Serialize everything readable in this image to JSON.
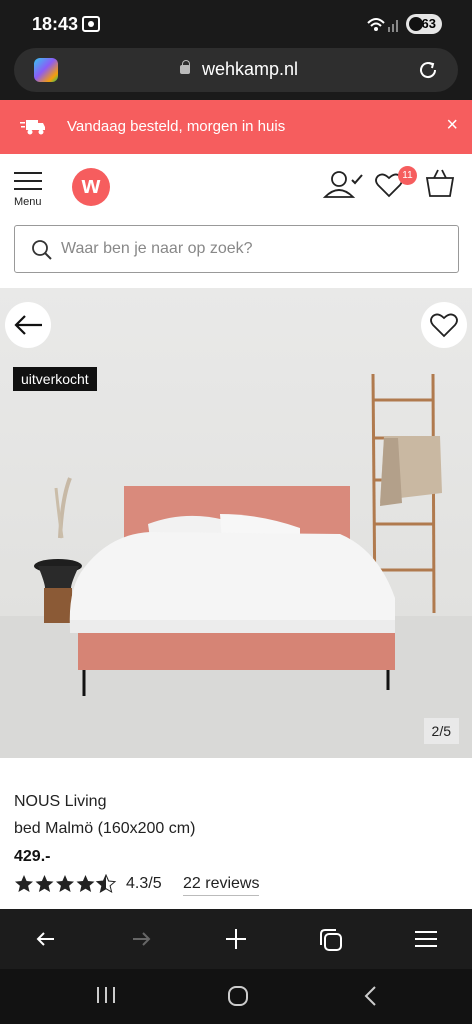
{
  "status": {
    "time": "18:43",
    "battery": "63"
  },
  "browser": {
    "url": "wehkamp.nl"
  },
  "promo": {
    "text": "Vandaag besteld, morgen in huis",
    "close": "×"
  },
  "header": {
    "logo_letter": "w",
    "menu_label": "Menu",
    "wishlist_count": "11",
    "search_placeholder": "Waar ben je naar op zoek?"
  },
  "gallery": {
    "badge": "uitverkocht",
    "counter": "2/5"
  },
  "product": {
    "brand": "NOUS Living",
    "name": "bed Malmö (160x200 cm)",
    "price": "429.-",
    "rating": "4.3/5",
    "rating_value": 4.3,
    "reviews": "22 reviews"
  },
  "colors": {
    "accent": "#f65d5e",
    "dark": "#1a1a1a"
  },
  "icons": [
    "copilot-icon",
    "lock-icon",
    "reload-icon",
    "truck-icon",
    "close-icon",
    "hamburger-icon",
    "user-icon",
    "heart-icon",
    "bag-icon",
    "search-icon",
    "arrow-left-icon",
    "arrow-right-icon",
    "plus-icon",
    "tabs-icon",
    "menu-icon"
  ]
}
